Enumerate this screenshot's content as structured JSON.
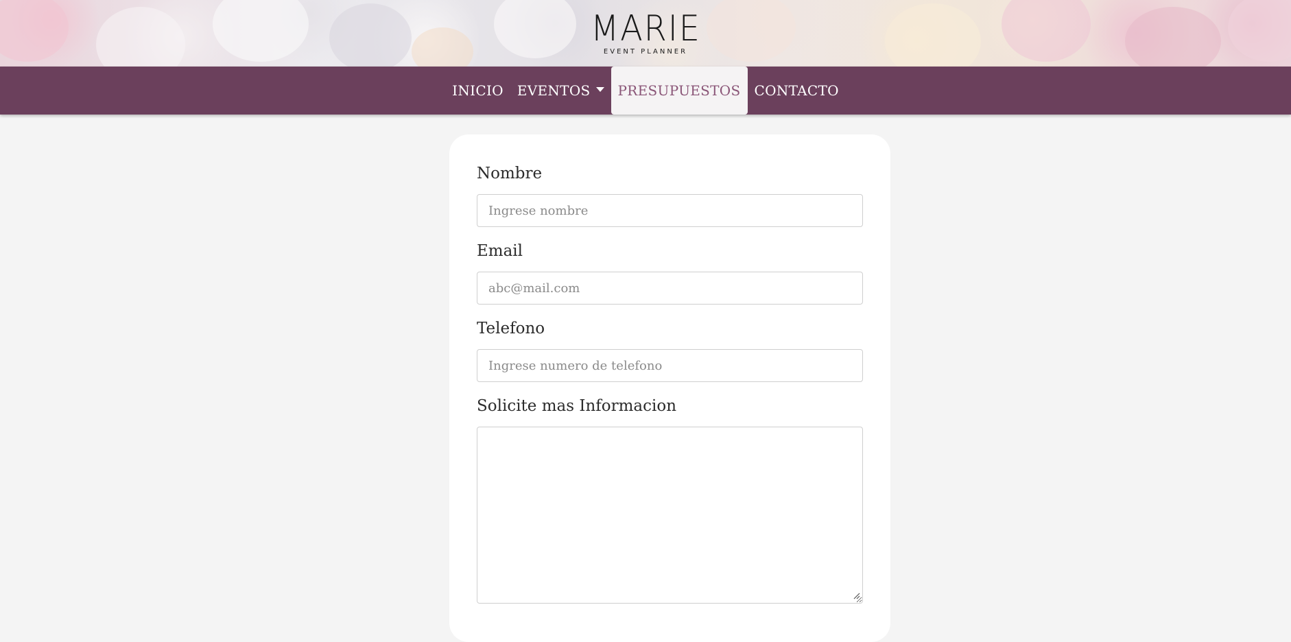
{
  "brand": {
    "name": "MARIE",
    "tagline": "EVENT PLANNER"
  },
  "nav": {
    "items": [
      {
        "label": "INICIO"
      },
      {
        "label": "EVENTOS",
        "dropdown": true
      },
      {
        "label": "PRESUPUESTOS",
        "active": true
      },
      {
        "label": "CONTACTO"
      }
    ]
  },
  "form": {
    "nombre": {
      "label": "Nombre",
      "placeholder": "Ingrese nombre"
    },
    "email": {
      "label": "Email",
      "placeholder": "abc@mail.com"
    },
    "telefono": {
      "label": "Telefono",
      "placeholder": "Ingrese numero de telefono"
    },
    "mensaje": {
      "label": "Solicite mas Informacion",
      "placeholder": ""
    }
  },
  "colors": {
    "nav_bg": "#6b405c",
    "nav_active_bg": "#f5f3f4",
    "nav_active_text": "#8a5577",
    "page_bg": "#f4f4f4"
  }
}
